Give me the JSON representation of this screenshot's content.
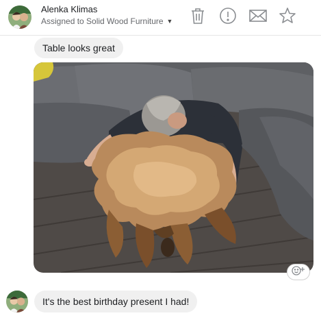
{
  "header": {
    "contact_name": "Alenka Klimas",
    "assignment_label": "Assigned to Solid Wood Furniture",
    "icons": {
      "avatar": "contact-avatar",
      "dropdown": "chevron-down-icon",
      "trash": "trash-icon",
      "spam": "exclamation-circle-icon",
      "mail": "envelope-icon",
      "star": "star-icon"
    }
  },
  "messages": [
    {
      "type": "text",
      "text": "Table looks great"
    },
    {
      "type": "image",
      "description_icon": "photo-table"
    },
    {
      "type": "text",
      "text": "It's the best birthday present I had!"
    }
  ],
  "reaction": {
    "icon": "add-reaction-icon"
  },
  "colors": {
    "bubble": "#f0f0f0",
    "text": "#1c1e21",
    "secondary_text": "#65676b",
    "icon_gray": "#8a8d91"
  }
}
